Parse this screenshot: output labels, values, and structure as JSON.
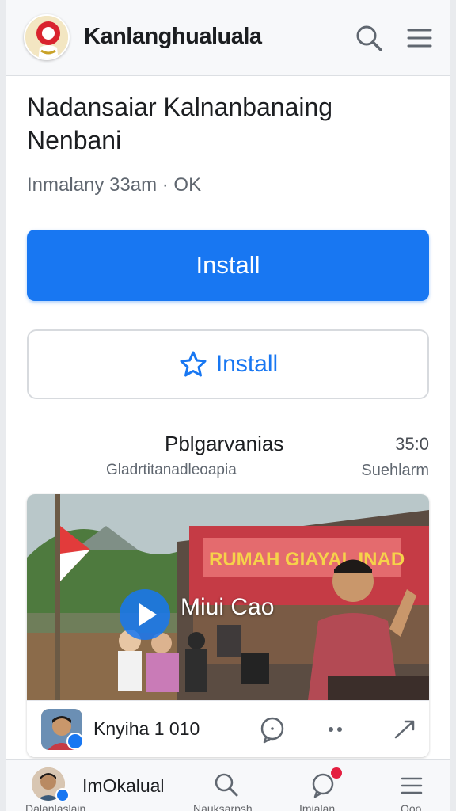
{
  "header": {
    "app_title": "Kanlanghualuala",
    "logo_icon": "app-logo-icon",
    "search_icon": "search-icon",
    "menu_icon": "menu-icon"
  },
  "page": {
    "title": "Nadansaiar Kalnanbanaing Nenbani",
    "meta": "Inmalany 33am · OK"
  },
  "actions": {
    "primary_label": "Install",
    "secondary_label": "Install",
    "secondary_icon": "star-icon"
  },
  "section": {
    "title": "Pblgarvanias",
    "time": "35:0",
    "subtitle": "Gladrtitanadleoapia",
    "subtitle_right": "Suehlarm"
  },
  "video": {
    "caption": "Miui Cao",
    "banner_text": "RUMAH GIAYAL INAD",
    "play_icon": "play-icon",
    "footer_name": "Knyiha 1  010",
    "comment_icon": "comment-icon",
    "more_icon": "more-icon",
    "share_icon": "share-icon"
  },
  "bottom_nav": {
    "profile_name": "ImOkalual",
    "profile_sub": "Dalanlaslain",
    "search_label": "Nauksarpsh",
    "chat_label": "Imialan",
    "menu_label": "Ooo",
    "search_icon": "search-icon",
    "chat_icon": "chat-icon",
    "menu_icon": "menu-icon"
  },
  "colors": {
    "accent": "#1877f2",
    "badge": "#e41e3f",
    "background": "#e9ebee"
  }
}
